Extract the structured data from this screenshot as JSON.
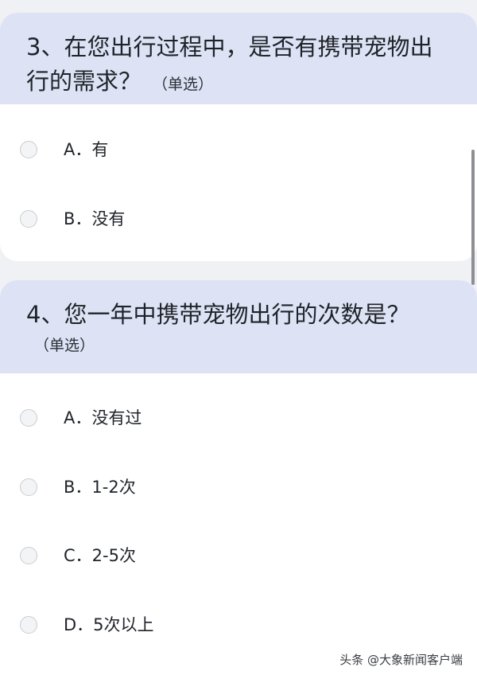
{
  "questions": [
    {
      "title": "3、在您出行过程中，是否有携带宠物出行的需求？",
      "tag": "（单选）",
      "options": [
        {
          "label": "A．有"
        },
        {
          "label": "B．没有"
        }
      ]
    },
    {
      "title": "4、您一年中携带宠物出行的次数是？",
      "tag": "（单选）",
      "options": [
        {
          "label": "A．没有过"
        },
        {
          "label": "B．1-2次"
        },
        {
          "label": "C．2-5次"
        },
        {
          "label": "D．5次以上"
        }
      ]
    }
  ],
  "watermark": "头条 @大象新闻客户端",
  "colors": {
    "background": "#f0f1f4",
    "header_bg": "#dde3f5",
    "card_bg": "#ffffff",
    "text": "#1f2329"
  }
}
